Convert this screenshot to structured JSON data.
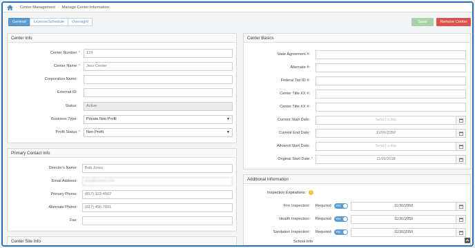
{
  "breadcrumb": {
    "items": [
      "Center Management",
      "Manage Center Information"
    ]
  },
  "tabs": [
    "General",
    "License/Schedule",
    "Oversight"
  ],
  "actions": {
    "save": "Save",
    "remove": "Remove Center"
  },
  "center_info": {
    "title": "Center Info",
    "center_number": {
      "label": "Center Number:",
      "value": "123"
    },
    "center_name": {
      "label": "Center Name:",
      "value": "Jess Center"
    },
    "corporation_name": {
      "label": "Corporation Name:",
      "value": ""
    },
    "external_id": {
      "label": "External ID:",
      "value": ""
    },
    "status": {
      "label": "Status:",
      "value": "Active"
    },
    "business_type": {
      "label": "Business Type:",
      "value": "Private Non Profit"
    },
    "profit_status": {
      "label": "Profit Status:",
      "value": "Non-Profit"
    }
  },
  "primary_contact": {
    "title": "Primary Contact Info",
    "directors_name": {
      "label": "Director's Name:",
      "value": "Bob Jones"
    },
    "email": {
      "label": "Email Address:",
      "value": "jess@center.com"
    },
    "primary_phone": {
      "label": "Primary Phone:",
      "value": "(817) 123-4567"
    },
    "alternate_phone": {
      "label": "Alternate Phone:",
      "value": "(817) 456-7891"
    },
    "fax": {
      "label": "Fax:",
      "value": ""
    }
  },
  "center_site": {
    "title": "Center Site Info"
  },
  "center_basics": {
    "title": "Center Basics",
    "state_agreement": {
      "label": "State Agreement #:",
      "value": ""
    },
    "alternate": {
      "label": "Alternate #:",
      "value": ""
    },
    "federal_tax": {
      "label": "Federal Tax ID #:",
      "value": ""
    },
    "title_xix_1": {
      "label": "Center Title XX #:",
      "value": ""
    },
    "title_xix_2": {
      "label": "Center Title XX #:",
      "value": ""
    },
    "current_start": {
      "label": "Current Start Date:",
      "placeholder": "Select a day"
    },
    "current_end": {
      "label": "Current End Date:",
      "value": "12/01/2050"
    },
    "allowed_start": {
      "label": "Allowed Start Date:",
      "placeholder": "Select a day"
    },
    "original_start": {
      "label": "Original Start Date:",
      "value": "11/01/2018"
    }
  },
  "additional": {
    "title": "Additional Information",
    "inspection_expirations": "Inspection Expirations:",
    "fire": {
      "label": "Fire Inspection:",
      "required": "Required",
      "toggle": "Yes",
      "value": "11/30/2050"
    },
    "health": {
      "label": "Health Inspection:",
      "required": "Required",
      "toggle": "Yes",
      "value": "11/30/2050"
    },
    "sanitation": {
      "label": "Sanitation Inspection:",
      "required": "Required",
      "toggle": "Yes",
      "value": "11/30/2050"
    },
    "school_info": "School Info"
  },
  "colors": {
    "accent": "#5a9bd0",
    "save": "#a9d4a9",
    "remove": "#d9534f",
    "frame": "#2a6fb3"
  }
}
